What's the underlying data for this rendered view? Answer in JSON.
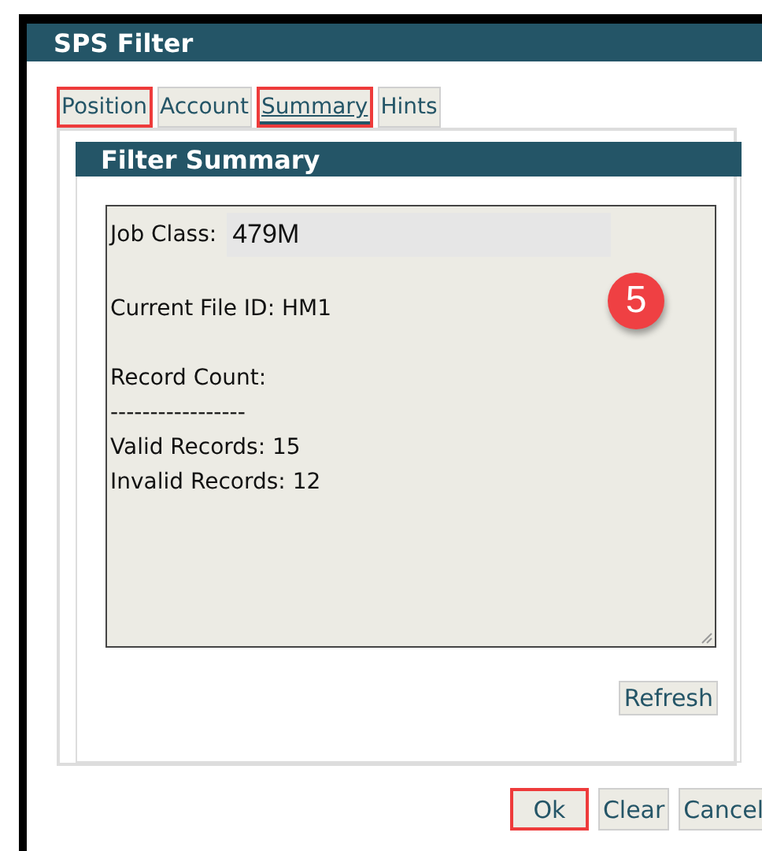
{
  "window": {
    "title": "SPS Filter"
  },
  "tabs": [
    {
      "label": "Position",
      "selected": false,
      "highlighted": true
    },
    {
      "label": "Account",
      "selected": false,
      "highlighted": false
    },
    {
      "label": "Summary",
      "selected": true,
      "highlighted": true
    },
    {
      "label": "Hints",
      "selected": false,
      "highlighted": false
    }
  ],
  "panel": {
    "title": "Filter Summary",
    "summary": {
      "job_class_label": "Job Class:",
      "job_class_value": "479M",
      "blocks": [
        [
          "Current File ID: HM1"
        ],
        [
          "Record Count:",
          "-----------------",
          "Valid Records: 15",
          "Invalid Records: 12"
        ]
      ]
    },
    "step_badge": "5",
    "refresh_button": "Refresh"
  },
  "buttons": [
    {
      "label": "Ok",
      "highlighted": true
    },
    {
      "label": "Clear",
      "highlighted": false
    },
    {
      "label": "Cancel",
      "highlighted": false
    }
  ]
}
